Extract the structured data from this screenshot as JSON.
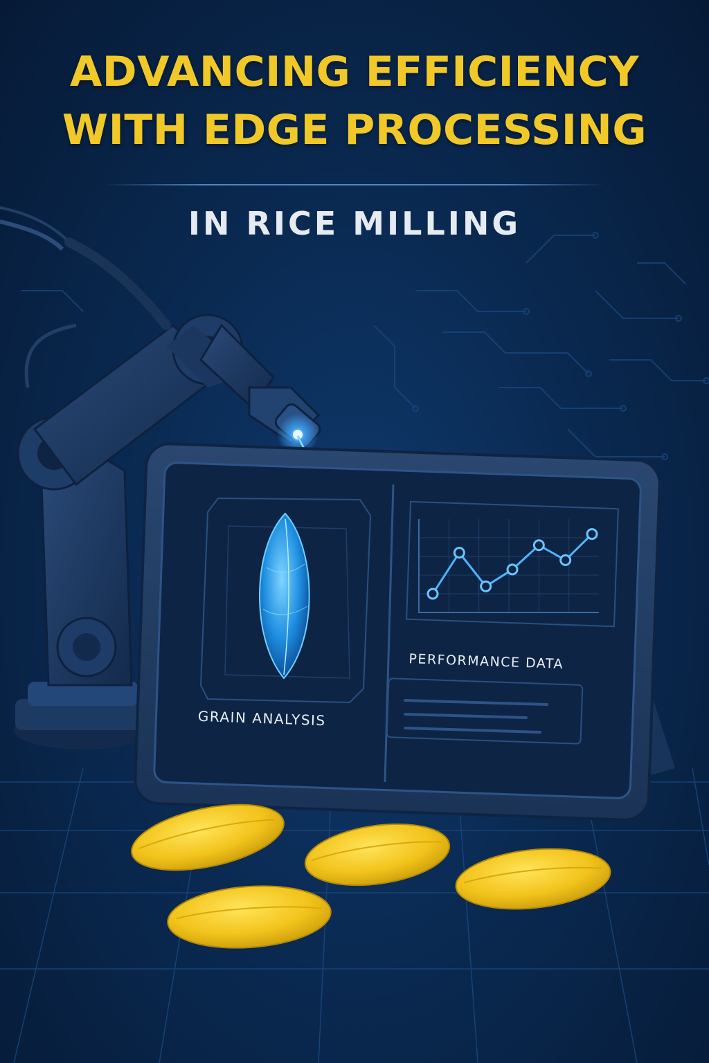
{
  "poster": {
    "title_line_1": "ADVANCING EFFICIENCY",
    "title_line_2": "WITH EDGE PROCESSING",
    "subtitle": "IN RICE MILLING"
  },
  "tablet": {
    "left_panel_label": "GRAIN ANALYSIS",
    "right_panel_label": "PERFORMANCE DATA"
  },
  "chart_data": {
    "type": "line",
    "x": [
      1,
      2,
      3,
      4,
      5,
      6,
      7
    ],
    "series": [
      {
        "values": [
          1.0,
          3.2,
          1.4,
          2.3,
          3.6,
          2.8,
          4.2
        ]
      }
    ],
    "title": "",
    "xlabel": "",
    "ylabel": "",
    "ylim": [
      0,
      5
    ],
    "grid": true
  },
  "icons": [
    "robot-arm-icon",
    "laser-beam-icon",
    "grain-scan-icon",
    "rice-grain-icon"
  ],
  "colors": {
    "accent_yellow": "#f0c929",
    "background_navy": "#0a2a52",
    "glow_blue": "#3fa9ff",
    "text_light": "#e6ebf2"
  }
}
